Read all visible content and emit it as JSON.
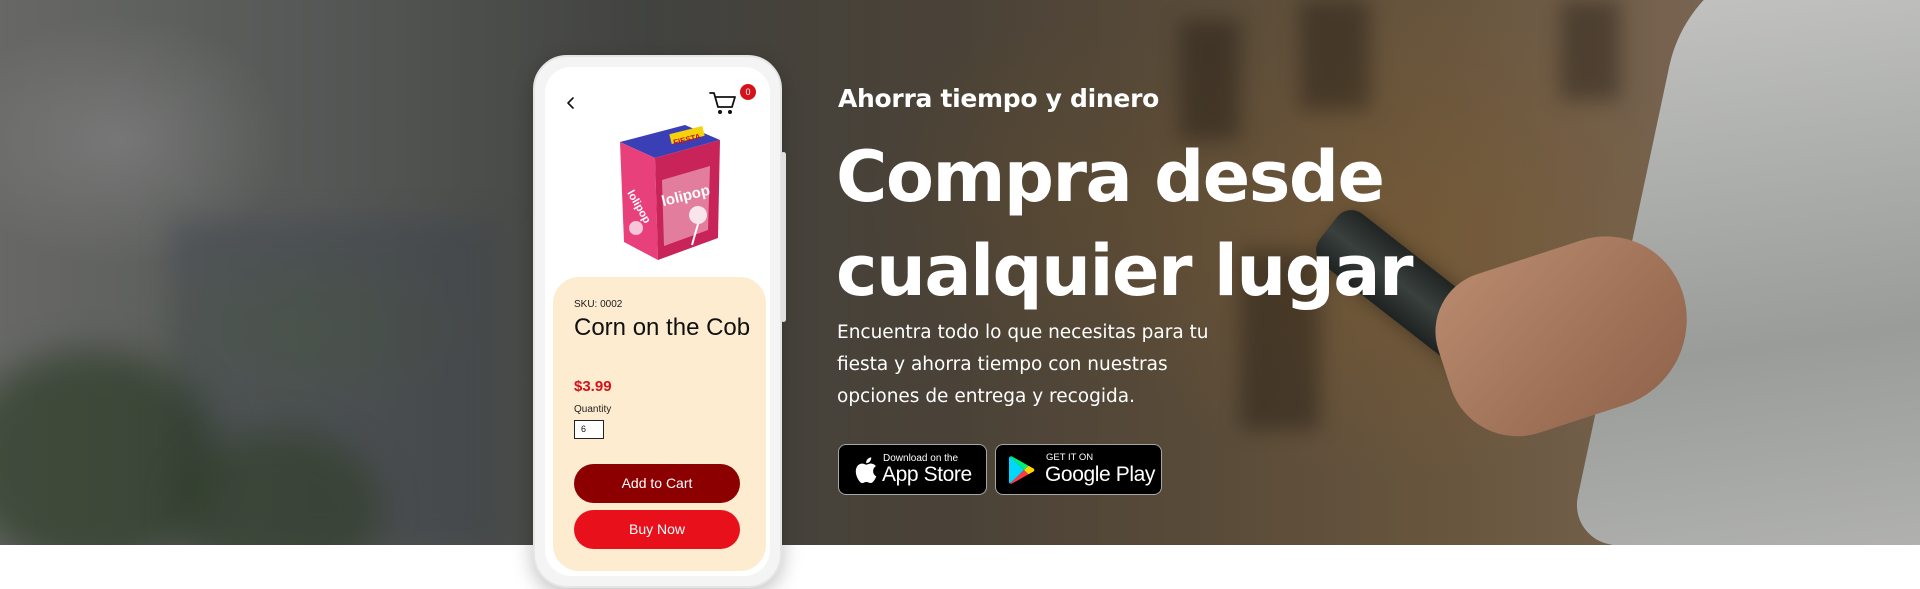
{
  "phone_mock": {
    "cart_count": "0",
    "product_box_label": "lolipop",
    "product_box_brand": "FIESTA",
    "sku": "SKU: 0002",
    "product_name": "Corn on the Cob",
    "price": "$3.99",
    "quantity_label": "Quantity",
    "quantity_value": "6",
    "add_to_cart_label": "Add to Cart",
    "buy_now_label": "Buy Now"
  },
  "hero": {
    "eyebrow": "Ahorra tiempo y dinero",
    "headline": "Compra desde cualquier lugar",
    "subtext": "Encuentra todo lo que necesitas para tu fiesta y ahorra tiempo con nuestras opciones de entrega y recogida."
  },
  "badges": {
    "app_store_small": "Download on the",
    "app_store_big": "App Store",
    "google_play_small": "GET IT ON",
    "google_play_big": "Google Play"
  },
  "icons": [
    "back-arrow-icon",
    "shopping-cart-icon",
    "apple-icon",
    "google-play-icon"
  ],
  "colors": {
    "accent_red": "#e8111b",
    "dark_red": "#8c0002",
    "card_cream": "#fdecd0"
  }
}
